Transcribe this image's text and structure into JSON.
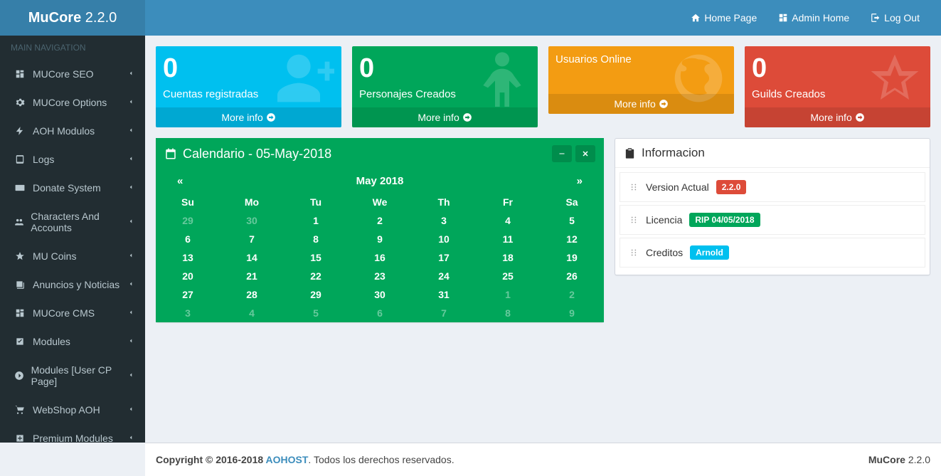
{
  "header": {
    "logo_bold": "MuCore",
    "logo_version": " 2.2.0",
    "nav": {
      "home_page": "Home Page",
      "admin_home": "Admin Home",
      "logout": "Log Out"
    }
  },
  "sidebar": {
    "title": "MAIN NAVIGATION",
    "items": [
      {
        "label": "MUCore SEO",
        "icon": "dashboard"
      },
      {
        "label": "MUCore Options",
        "icon": "gears"
      },
      {
        "label": "AOH Modulos",
        "icon": "bolt"
      },
      {
        "label": "Logs",
        "icon": "tablet"
      },
      {
        "label": "Donate System",
        "icon": "credit-card"
      },
      {
        "label": "Characters And Accounts",
        "icon": "users"
      },
      {
        "label": "MU Coins",
        "icon": "star"
      },
      {
        "label": "Anuncios y Noticias",
        "icon": "news"
      },
      {
        "label": "MUCore CMS",
        "icon": "dashboard"
      },
      {
        "label": "Modules",
        "icon": "check-square"
      },
      {
        "label": "Modules [User CP Page]",
        "icon": "circle-right"
      },
      {
        "label": "WebShop AOH",
        "icon": "cart"
      },
      {
        "label": "Premium Modules",
        "icon": "plus-square"
      }
    ]
  },
  "stats": {
    "accounts": {
      "value": "0",
      "label": "Cuentas registradas",
      "more": "More info"
    },
    "characters": {
      "value": "0",
      "label": "Personajes Creados",
      "more": "More info"
    },
    "online": {
      "label": "Usuarios Online",
      "more": "More info"
    },
    "guilds": {
      "value": "0",
      "label": "Guilds Creados",
      "more": "More info"
    }
  },
  "calendar": {
    "title": "Calendario - 05-May-2018",
    "month": "May 2018",
    "prev": "«",
    "next": "»",
    "days": [
      "Su",
      "Mo",
      "Tu",
      "We",
      "Th",
      "Fr",
      "Sa"
    ],
    "weeks": [
      [
        {
          "d": "29",
          "o": true
        },
        {
          "d": "30",
          "o": true
        },
        {
          "d": "1"
        },
        {
          "d": "2"
        },
        {
          "d": "3"
        },
        {
          "d": "4"
        },
        {
          "d": "5"
        }
      ],
      [
        {
          "d": "6"
        },
        {
          "d": "7"
        },
        {
          "d": "8"
        },
        {
          "d": "9"
        },
        {
          "d": "10"
        },
        {
          "d": "11"
        },
        {
          "d": "12"
        }
      ],
      [
        {
          "d": "13"
        },
        {
          "d": "14"
        },
        {
          "d": "15"
        },
        {
          "d": "16"
        },
        {
          "d": "17"
        },
        {
          "d": "18"
        },
        {
          "d": "19"
        }
      ],
      [
        {
          "d": "20"
        },
        {
          "d": "21"
        },
        {
          "d": "22"
        },
        {
          "d": "23"
        },
        {
          "d": "24"
        },
        {
          "d": "25"
        },
        {
          "d": "26"
        }
      ],
      [
        {
          "d": "27"
        },
        {
          "d": "28"
        },
        {
          "d": "29"
        },
        {
          "d": "30"
        },
        {
          "d": "31"
        },
        {
          "d": "1",
          "o": true
        },
        {
          "d": "2",
          "o": true
        }
      ],
      [
        {
          "d": "3",
          "o": true
        },
        {
          "d": "4",
          "o": true
        },
        {
          "d": "5",
          "o": true
        },
        {
          "d": "6",
          "o": true
        },
        {
          "d": "7",
          "o": true
        },
        {
          "d": "8",
          "o": true
        },
        {
          "d": "9",
          "o": true
        }
      ]
    ]
  },
  "info": {
    "title": "Informacion",
    "version_label": "Version Actual",
    "version_badge": "2.2.0",
    "license_label": "Licencia",
    "license_badge": "RIP 04/05/2018",
    "credits_label": "Creditos",
    "credits_badge": "Arnold"
  },
  "footer": {
    "copyright_prefix": "Copyright © 2016-2018 ",
    "company": "AOHOST",
    "suffix": ". Todos los derechos reservados.",
    "right_bold": "MuCore",
    "right_ver": " 2.2.0"
  }
}
